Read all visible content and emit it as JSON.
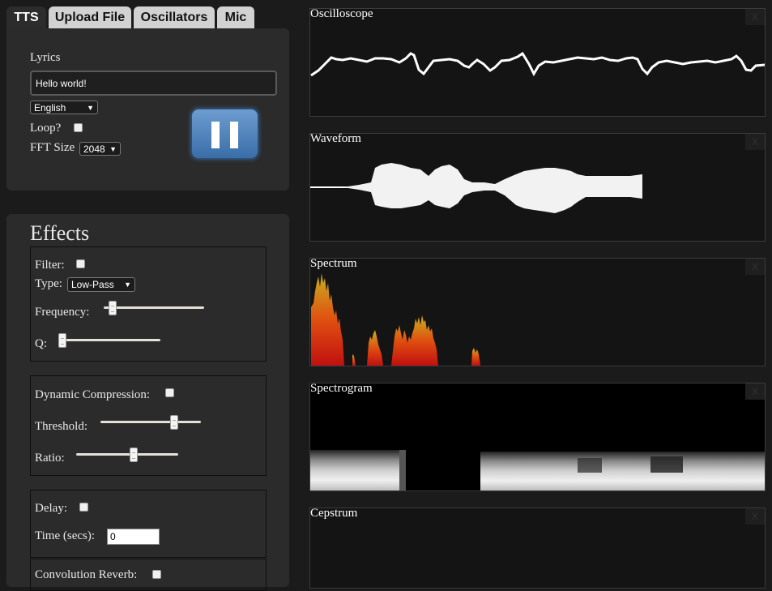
{
  "tabs": [
    {
      "label": "TTS",
      "active": true
    },
    {
      "label": "Upload File",
      "active": false
    },
    {
      "label": "Oscillators",
      "active": false
    },
    {
      "label": "Mic",
      "active": false
    }
  ],
  "tts": {
    "lyrics_label": "Lyrics",
    "lyrics_value": "Hello world!",
    "language": "English",
    "loop_label": "Loop?",
    "fft_label": "FFT Size",
    "fft_value": "2048",
    "play_state": "pause"
  },
  "effects": {
    "title": "Effects",
    "filter": {
      "label": "Filter:",
      "type_label": "Type:",
      "type_value": "Low-Pass",
      "frequency_label": "Frequency:",
      "frequency_level": 0.05,
      "q_label": "Q:",
      "q_level": 0.0
    },
    "compression": {
      "label": "Dynamic Compression:",
      "threshold_label": "Threshold:",
      "threshold_level": 0.75,
      "ratio_label": "Ratio:",
      "ratio_level": 0.57
    },
    "delay": {
      "label": "Delay:",
      "time_label": "Time (secs):",
      "time_value": "0"
    },
    "reverb": {
      "label": "Convolution Reverb:"
    }
  },
  "visualizers": [
    {
      "title": "Oscilloscope",
      "close": "X"
    },
    {
      "title": "Waveform",
      "close": "X"
    },
    {
      "title": "Spectrum",
      "close": "X"
    },
    {
      "title": "Spectrogram",
      "close": "X"
    },
    {
      "title": "Cepstrum",
      "close": "X"
    }
  ]
}
